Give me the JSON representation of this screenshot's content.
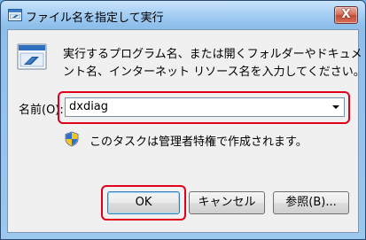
{
  "window": {
    "title": "ファイル名を指定して実行",
    "close_label": "X"
  },
  "description": {
    "line1": "実行するプログラム名、または開くフォルダーやドキュメ",
    "line2": "ント名、インターネット リソース名を入力してください。"
  },
  "name_field": {
    "label": "名前(O):",
    "value": "dxdiag"
  },
  "admin_note": "このタスクは管理者特権で作成されます。",
  "buttons": {
    "ok": "OK",
    "cancel": "キャンセル",
    "browse": "参照(B)..."
  },
  "colors": {
    "highlight": "#e0001c",
    "titlebar": "#a8d0f4",
    "client": "#f0f0f0"
  },
  "icons": {
    "app": "run-icon",
    "title": "run-icon",
    "close": "close-icon",
    "combo": "chevron-down-icon",
    "admin": "shield-icon"
  }
}
